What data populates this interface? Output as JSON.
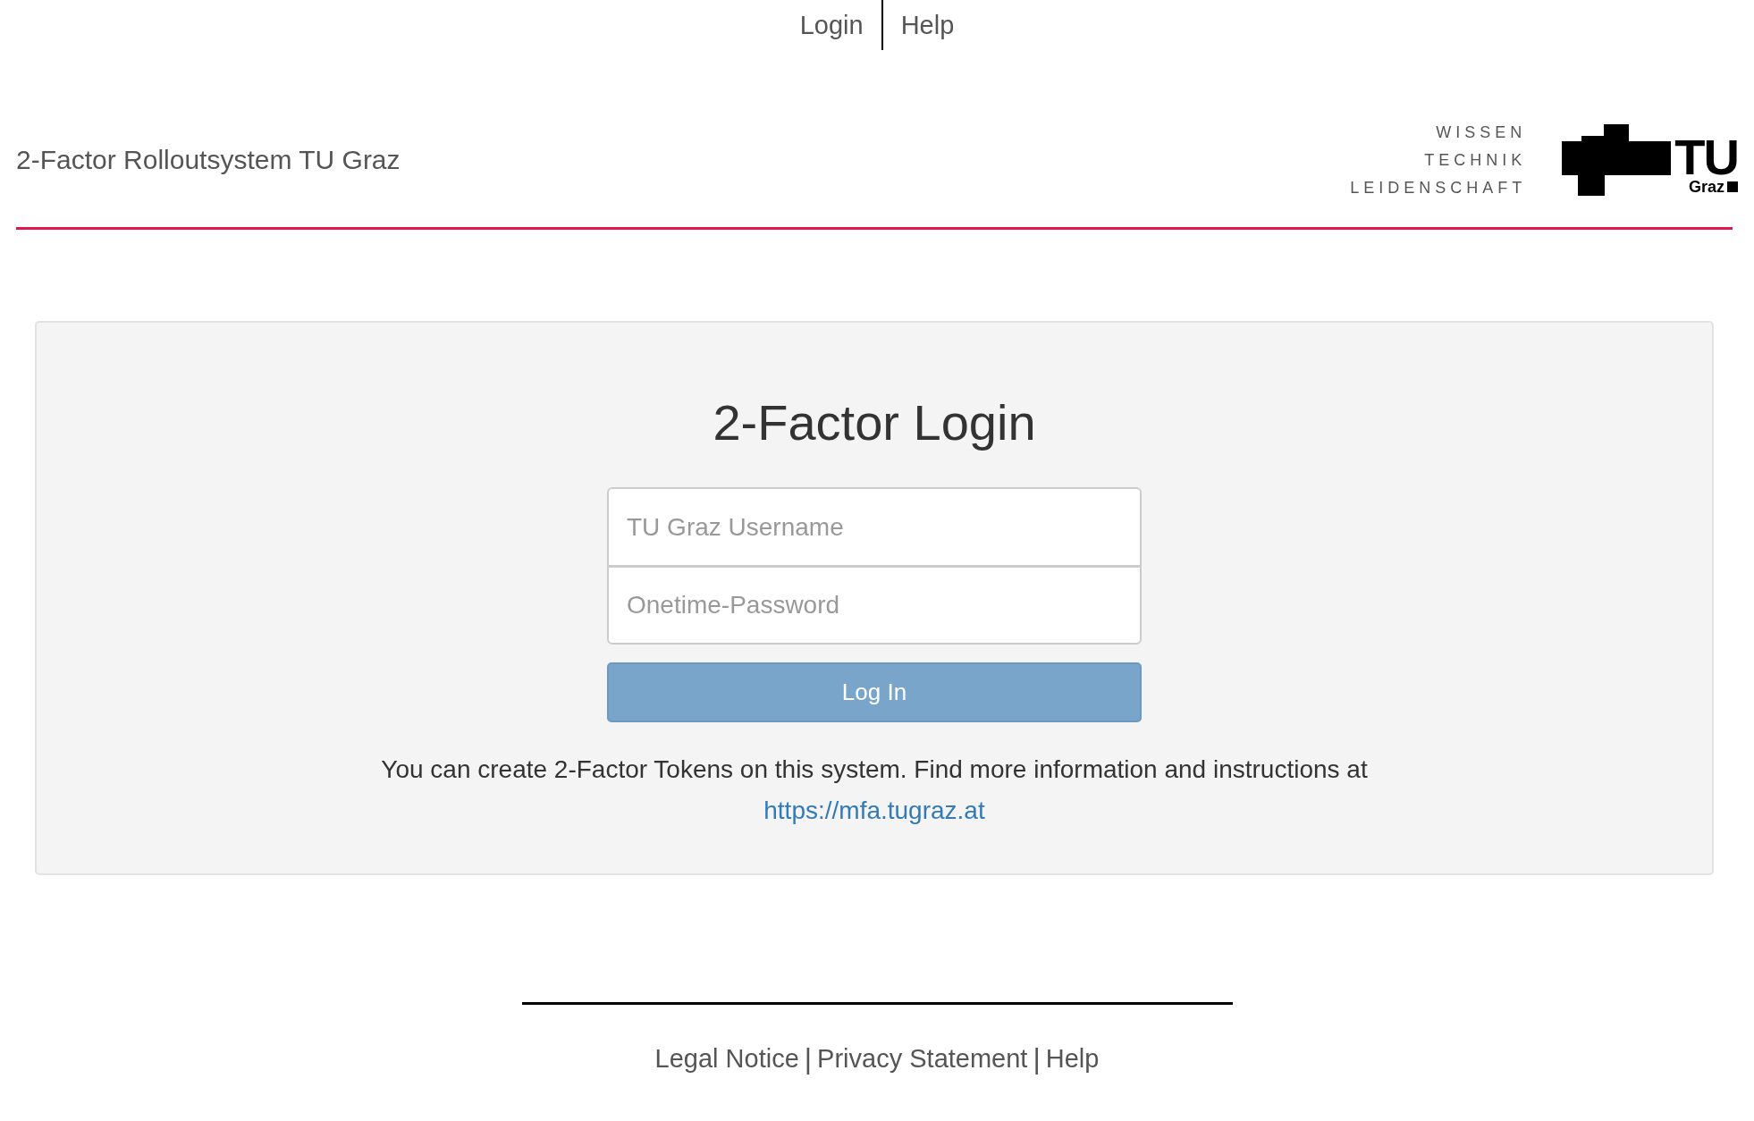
{
  "top_nav": [
    {
      "label": "Login"
    },
    {
      "label": "Help"
    }
  ],
  "header": {
    "title": "2-Factor Rolloutsystem TU Graz",
    "slogan": [
      "WISSEN",
      "TECHNIK",
      "LEIDENSCHAFT"
    ],
    "logo_word": "TU",
    "logo_sub": "Graz"
  },
  "login": {
    "title": "2-Factor Login",
    "fields": [
      {
        "placeholder": "TU Graz Username"
      },
      {
        "placeholder": "Onetime-Password"
      }
    ],
    "button": "Log In",
    "info": "You can create 2-Factor Tokens on this system. Find more information and instructions at",
    "link": "https://mfa.tugraz.at"
  },
  "footer": {
    "items": [
      {
        "kind": "link",
        "text": "Legal Notice"
      },
      {
        "kind": "separator",
        "text": "|"
      },
      {
        "kind": "link",
        "text": "Privacy Statement"
      },
      {
        "kind": "separator",
        "text": "|"
      },
      {
        "kind": "link",
        "text": "Help"
      }
    ]
  }
}
